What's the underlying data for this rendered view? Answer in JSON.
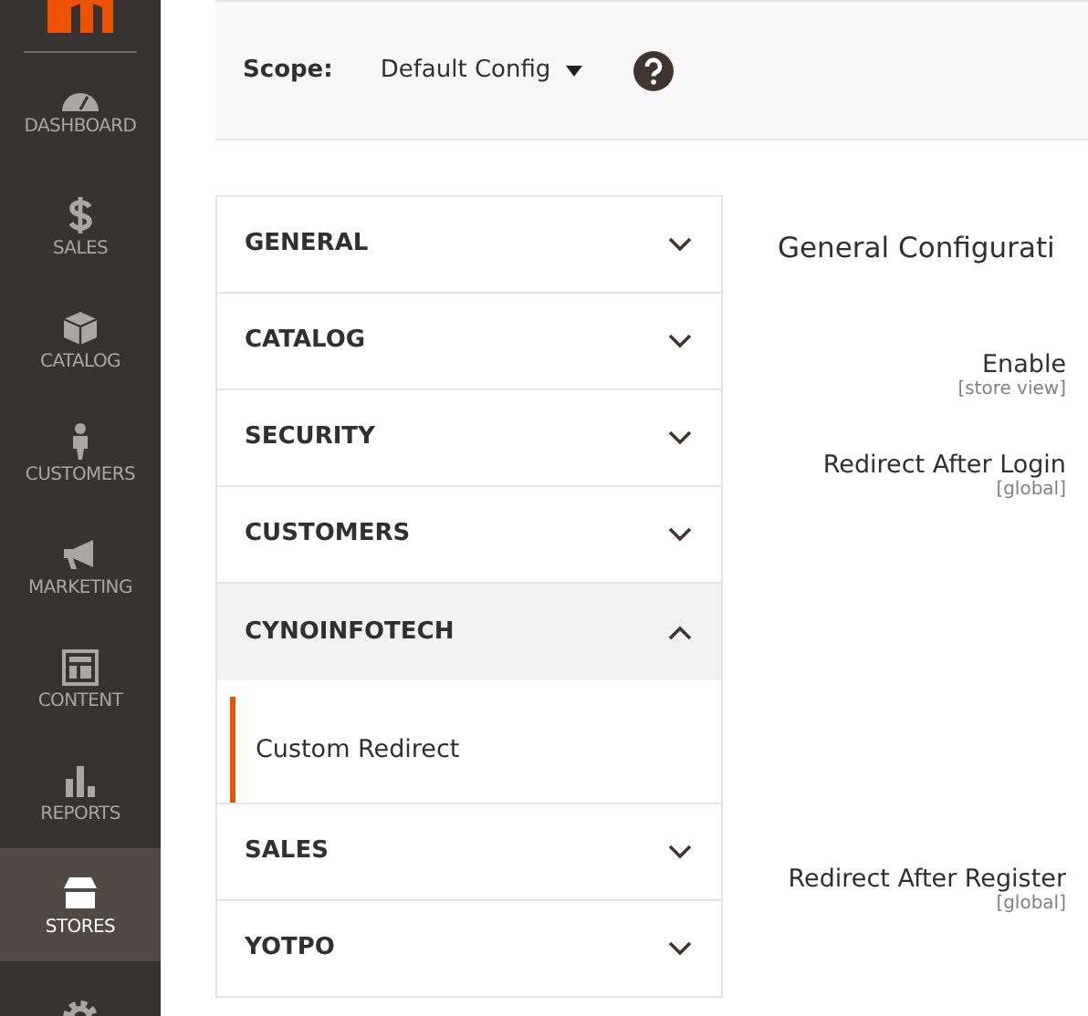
{
  "sidebar": {
    "items": [
      {
        "kind": "dashboard",
        "label": "DASHBOARD",
        "selected": false
      },
      {
        "kind": "sales",
        "label": "SALES",
        "selected": false
      },
      {
        "kind": "catalog",
        "label": "CATALOG",
        "selected": false
      },
      {
        "kind": "customers",
        "label": "CUSTOMERS",
        "selected": false
      },
      {
        "kind": "marketing",
        "label": "MARKETING",
        "selected": false
      },
      {
        "kind": "content",
        "label": "CONTENT",
        "selected": false
      },
      {
        "kind": "reports",
        "label": "REPORTS",
        "selected": false
      },
      {
        "kind": "stores",
        "label": "STORES",
        "selected": true
      },
      {
        "kind": "system",
        "selected": false
      }
    ]
  },
  "scope": {
    "label": "Scope:",
    "value": "Default Config"
  },
  "config_tabs": [
    {
      "label": "GENERAL",
      "expanded": false
    },
    {
      "label": "CATALOG",
      "expanded": false
    },
    {
      "label": "SECURITY",
      "expanded": false
    },
    {
      "label": "CUSTOMERS",
      "expanded": false
    },
    {
      "label": "CYNOINFOTECH",
      "expanded": true,
      "children": [
        {
          "label": "Custom Redirect",
          "selected": true
        }
      ]
    },
    {
      "label": "SALES",
      "expanded": false
    },
    {
      "label": "YOTPO",
      "expanded": false
    }
  ],
  "section": {
    "title": "General Configurati",
    "fields": [
      {
        "label": "Enable",
        "scope": "[store view]"
      },
      {
        "label": "Redirect After Login",
        "scope": "[global]"
      },
      {
        "label": "Redirect After Register",
        "scope": "[global]"
      }
    ]
  }
}
